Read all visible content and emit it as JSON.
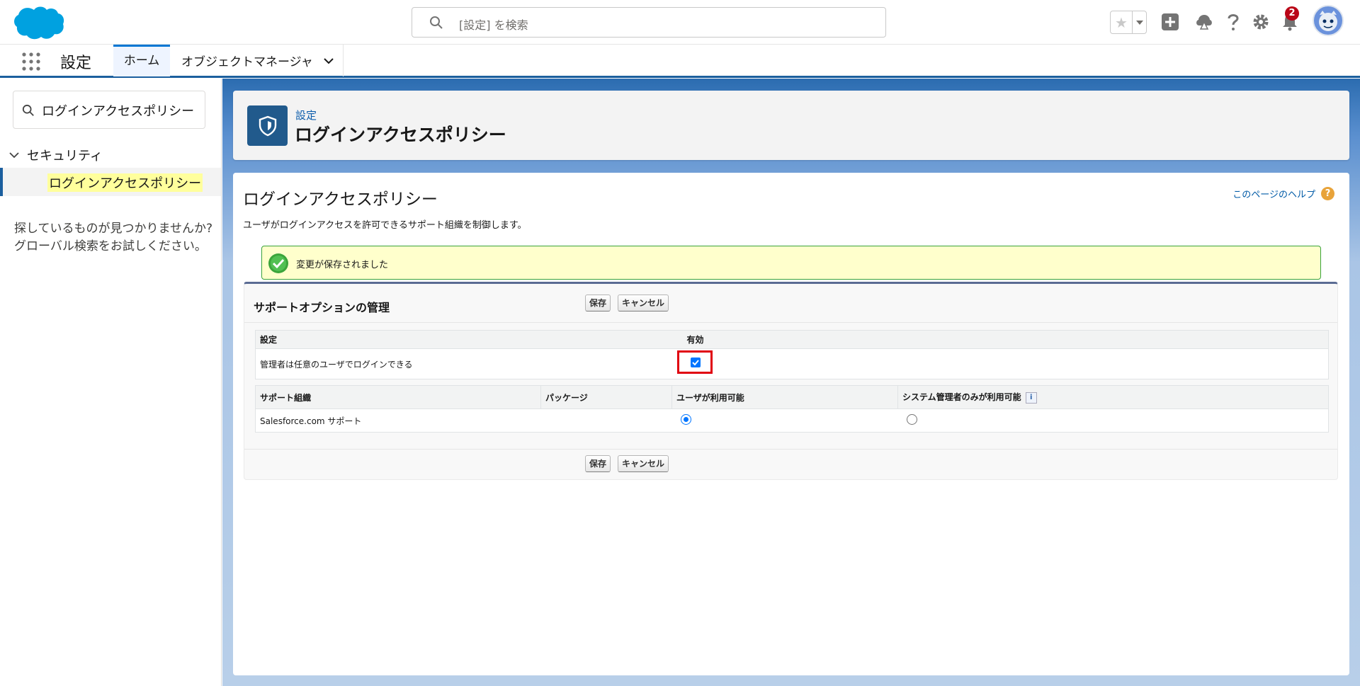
{
  "header": {
    "search_placeholder": "[設定] を検索",
    "notification_count": "2",
    "icons": [
      "salesforce-logo",
      "star-icon",
      "add-icon",
      "trailhead-icon",
      "help-icon",
      "gear-icon",
      "bell-icon",
      "avatar"
    ]
  },
  "context_bar": {
    "app_name": "設定",
    "tabs": [
      {
        "label": "ホーム",
        "active": true
      },
      {
        "label": "オブジェクトマネージャ",
        "active": false
      }
    ]
  },
  "sidebar": {
    "search_value": "ログインアクセスポリシー",
    "section": "セキュリティ",
    "selected_item": "ログインアクセスポリシー",
    "help_line1": "探しているものが見つかりませんか?",
    "help_line2": "グローバル検索をお試しください。"
  },
  "page_header": {
    "breadcrumb": "設定",
    "title": "ログインアクセスポリシー"
  },
  "content": {
    "title": "ログインアクセスポリシー",
    "help_link": "このページのヘルプ",
    "description": "ユーザがログインアクセスを許可できるサポート組織を制御します。",
    "message": "変更が保存されました"
  },
  "block": {
    "title": "サポートオプションの管理",
    "save_label": "保存",
    "cancel_label": "キャンセル",
    "settings_table": {
      "headers": [
        "設定",
        "有効"
      ],
      "rows": [
        {
          "label": "管理者は任意のユーザでログインできる",
          "enabled": true
        }
      ]
    },
    "support_table": {
      "headers": [
        "サポート組織",
        "パッケージ",
        "ユーザが利用可能",
        "システム管理者のみが利用可能"
      ],
      "rows": [
        {
          "org": "Salesforce.com サポート",
          "package": "",
          "users_available": true,
          "admins_only": false
        }
      ]
    }
  },
  "colors": {
    "brand_blue": "#0176d3",
    "header_blue": "#1b5f9e",
    "highlight_red": "#e00010",
    "success_bg": "#ffffcc"
  }
}
